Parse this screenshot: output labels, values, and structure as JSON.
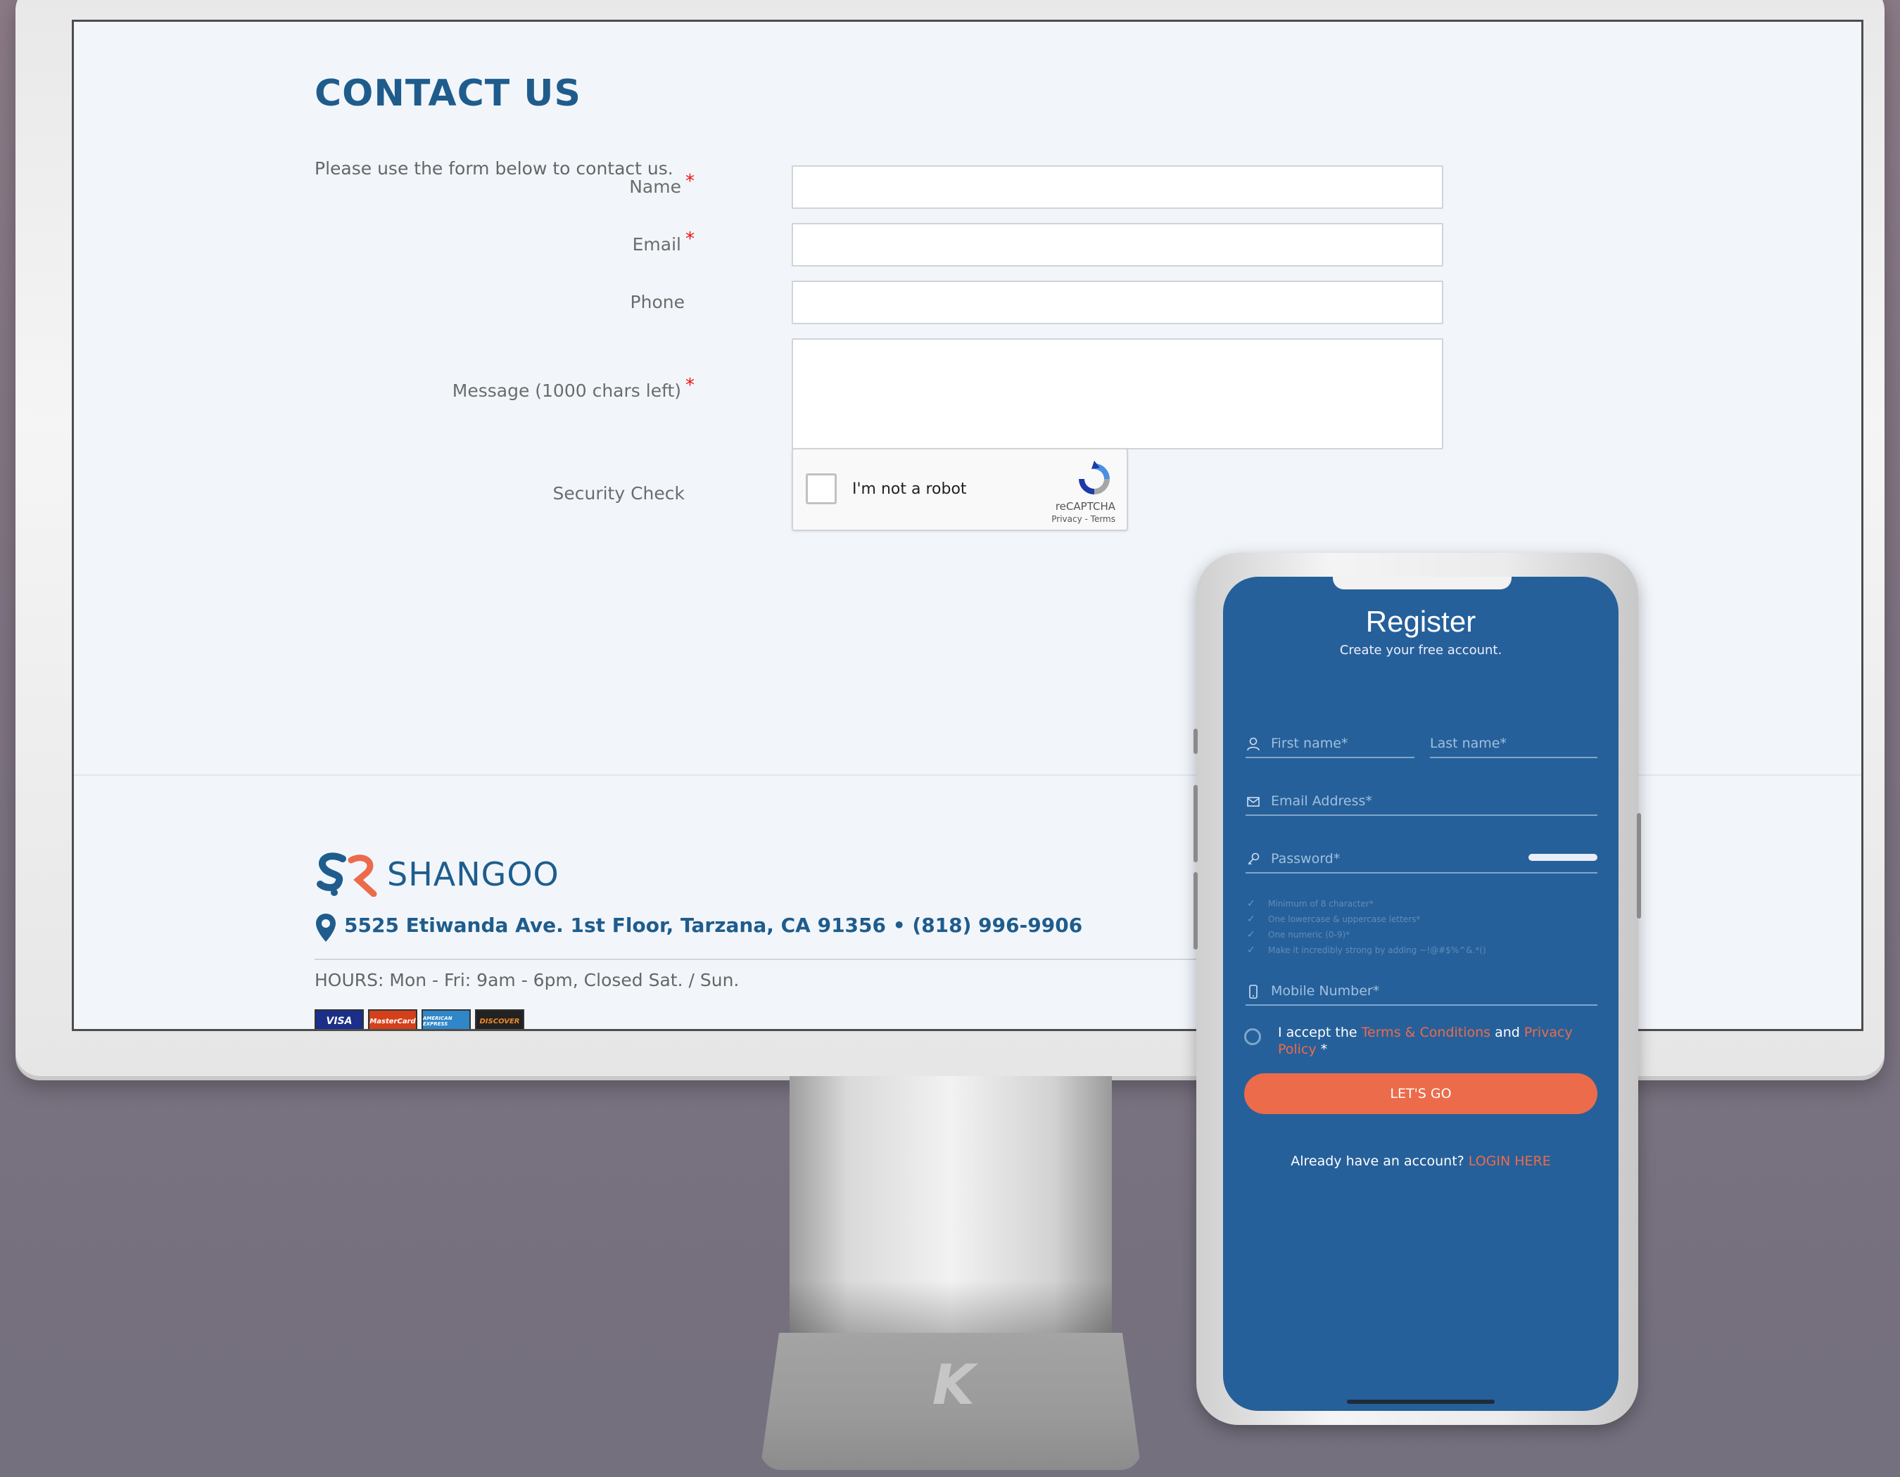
{
  "contact": {
    "title": "CONTACT US",
    "intro": "Please use the form below to contact us.",
    "fields": {
      "name_label": "Name",
      "email_label": "Email",
      "phone_label": "Phone",
      "message_label": "Message (1000 chars left)",
      "security_label": "Security Check",
      "required_mark": "*"
    },
    "recaptcha": {
      "checkbox_label": "I'm not a robot",
      "brand": "reCAPTCHA",
      "links": "Privacy - Terms"
    }
  },
  "footer": {
    "brand": "SHANGOO",
    "address": "5525 Etiwanda Ave. 1st Floor, Tarzana, CA 91356 • (818) 996-9906",
    "hours": "HOURS: Mon - Fri: 9am - 6pm, Closed Sat. / Sun.",
    "cards": [
      {
        "label": "VISA",
        "color": "#1a2e8a"
      },
      {
        "label": "MasterCard",
        "color": "#d4401a"
      },
      {
        "label": "AMERICAN EXPRESS",
        "color": "#2f86c8"
      },
      {
        "label": "DISCOVER",
        "color": "#222222"
      }
    ]
  },
  "stand_logo": "K",
  "register": {
    "title": "Register",
    "subtitle": "Create your free account.",
    "first_name": "First name*",
    "last_name": "Last name*",
    "email": "Email Address*",
    "password": "Password*",
    "hints": [
      "Minimum of 8 character*",
      "One lowercase & uppercase letters*",
      "One numeric (0-9)*",
      "Make it incredibly strong by adding ~!@#$%^&.*()"
    ],
    "mobile": "Mobile Number*",
    "accept_prefix": "I accept the ",
    "terms_link": "Terms & Conditions",
    "accept_and": " and  ",
    "privacy_link": "Privacy Policy",
    "accept_suffix": " *",
    "cta": "LET'S GO",
    "already_prefix": "Already have an account? ",
    "login_link": "LOGIN HERE"
  },
  "colors": {
    "brand_blue": "#1f5c8c",
    "phone_bg": "#26609a",
    "accent_orange": "#ec6b4a",
    "required_red": "#ee1111"
  }
}
